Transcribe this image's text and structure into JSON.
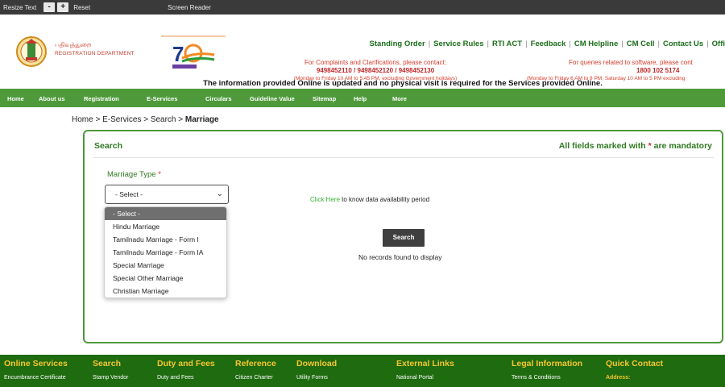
{
  "topbar": {
    "resize_text": "Resize Text",
    "decrease": "-",
    "increase": "+",
    "reset": "Reset",
    "screen_reader": "Screen Reader"
  },
  "header": {
    "dept_tamil": "பதிவுத்துறை",
    "dept_english": "REGISTRATION DEPARTMENT",
    "links": [
      "Standing Order",
      "Service Rules",
      "RTI ACT",
      "Feedback",
      "CM Helpline",
      "CM Cell",
      "Contact Us",
      "Offi"
    ],
    "complaints": {
      "line1": "For Complaints and Clarifications, please contact:",
      "phones": "9498452110 / 9498452120 / 9498452130",
      "hours": "(Monday to Friday 10 AM to 5.45 PM, excluding Government holidays)"
    },
    "software": {
      "line1": "For queries related to software, please cont",
      "phone": "1800 102 5174",
      "hours": "(Monday to Friday 6 AM to 8 PM, Saturday 10 AM to 5 PM excluding"
    },
    "notice": "The information provided Online is updated and no physical visit is required for the Services provided Online."
  },
  "nav": {
    "items": [
      "Home",
      "About us",
      "Registration",
      "E-Services",
      "Circulars",
      "Guideline Value",
      "Sitemap",
      "Help",
      "More"
    ]
  },
  "breadcrumb": {
    "path": "Home > E-Services > Search > ",
    "current": "Marriage"
  },
  "panel": {
    "title": "Search",
    "mandatory_prefix": "All fields marked with ",
    "mandatory_star": "*",
    "mandatory_suffix": " are mandatory",
    "marriage_type_label": "Marriage Type ",
    "required_star": "*",
    "select_value": "- Select -",
    "click_here_link": "Click Here",
    "click_here_text": " to know data availability period",
    "search_button": "Search",
    "no_records": "No records found to display"
  },
  "dropdown": {
    "options": [
      "- Select -",
      "Hindu Marriage",
      "Tamilnadu Marriage - Form I",
      "Tamilnadu Marriage - Form IA",
      "Special Marriage",
      "Special Other Marriage",
      "Christian Marriage"
    ],
    "selected_index": 0
  },
  "footer": {
    "headings": [
      "Online Services",
      "Search",
      "Duty and Fees",
      "Reference",
      "Download",
      "External Links",
      "Legal Information",
      "Quick Contact"
    ],
    "items": [
      "Encumbrance Certificate",
      "Stamp Vendor",
      "Duty and Fees",
      "Citizen Charter",
      "Utility Forms",
      "National Portal",
      "Terms & Conditions",
      "Address:"
    ]
  },
  "colors": {
    "brand_green": "#4e9a3a",
    "footer_green": "#1f6b10",
    "footer_heading": "#f7c62f",
    "alert_red": "#d63e2c"
  }
}
